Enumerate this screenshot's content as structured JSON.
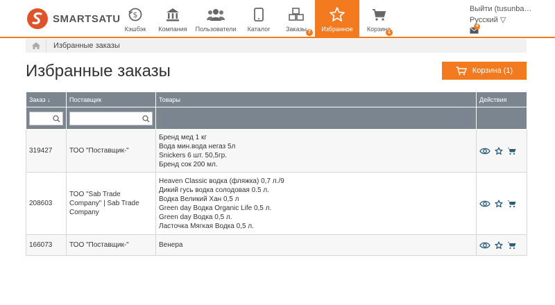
{
  "brand": {
    "name": "SMARTSATU",
    "accent": "#f47a20"
  },
  "nav": [
    {
      "label": "Кэшбэк",
      "icon": "cashback-icon",
      "active": false
    },
    {
      "label": "Компания",
      "icon": "bank-icon",
      "active": false
    },
    {
      "label": "Пользователи",
      "icon": "users-icon",
      "active": false
    },
    {
      "label": "Каталог",
      "icon": "tablet-icon",
      "active": false
    },
    {
      "label": "Заказы",
      "icon": "cubes-icon",
      "active": false,
      "badge": "7"
    },
    {
      "label": "Избранное",
      "icon": "star-icon",
      "active": true
    },
    {
      "label": "Корзина",
      "icon": "cart-icon",
      "active": false,
      "badge": "1"
    }
  ],
  "user": {
    "logout": "Выйти (tusunba…",
    "language": "Русский ▽",
    "mail_badge": "4"
  },
  "breadcrumb": {
    "current": "Избранные заказы"
  },
  "page": {
    "title": "Избранные заказы",
    "cart_button": "Корзина (1)"
  },
  "table": {
    "columns": {
      "order": "Заказ ↓",
      "supplier": "Поставщик",
      "goods": "Товары",
      "actions": "Действия"
    },
    "rows": [
      {
        "order": "319427",
        "supplier": "ТОО \"Поставщик-\"",
        "goods": [
          "Бренд мед 1 кг",
          "Вода мин.вода негаз 5л",
          "Snickers 6 шт. 50,5гр.",
          "Бренд сок 200 мл."
        ]
      },
      {
        "order": "208603",
        "supplier": "ТОО \"Sab Trade Company\" | Sab Trade Company",
        "goods": [
          "Heaven Classic водка (фляжка) 0,7 л./9",
          "Дикий гусь водка солодовая 0.5 л.",
          "Водка Великий Хан 0,5 л",
          "Green day Водка Organic Life 0,5 л.",
          "Green day Водка 0,5 л.",
          "Ласточка Мягкая Водка 0,5 л."
        ]
      },
      {
        "order": "166073",
        "supplier": "ТОО \"Поставщик-\"",
        "goods": [
          "Венера"
        ]
      }
    ]
  }
}
